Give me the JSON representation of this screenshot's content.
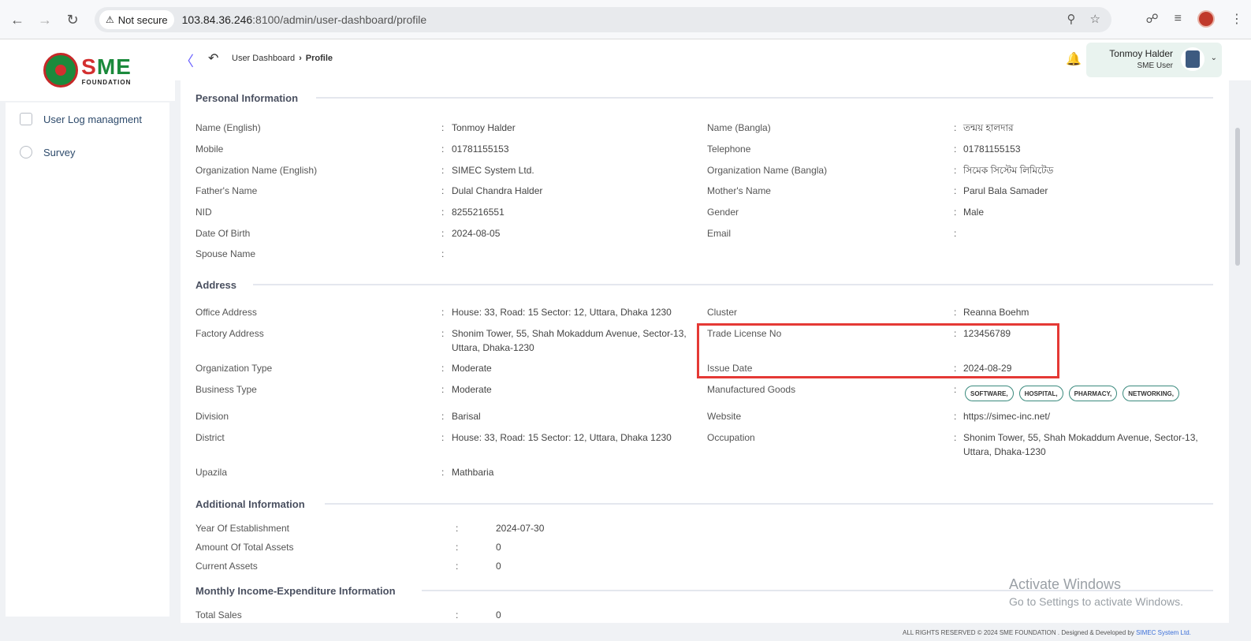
{
  "browser": {
    "security_label": "Not secure",
    "url_host": "103.84.36.246",
    "url_rest": ":8100/admin/user-dashboard/profile"
  },
  "logo": {
    "sme_s": "S",
    "sme_m": "M",
    "sme_e": "E",
    "foundation": "FOUNDATION"
  },
  "sidebar": {
    "items": [
      {
        "label": "User Log managment",
        "icon": "log-icon"
      },
      {
        "label": "Survey",
        "icon": "pie-chart-icon"
      }
    ]
  },
  "header": {
    "breadcrumb_parent": "User Dashboard",
    "breadcrumb_current": "Profile",
    "user_name": "Tonmoy Halder",
    "user_role": "SME User"
  },
  "sections": {
    "personal": "Personal Information",
    "address": "Address",
    "additional": "Additional Information",
    "monthly": "Monthly Income-Expenditure Information"
  },
  "personal": {
    "name_en_label": "Name (English)",
    "name_en": "Tonmoy Halder",
    "name_bn_label": "Name (Bangla)",
    "name_bn": "তন্ময় হালদার",
    "mobile_label": "Mobile",
    "mobile": "01781155153",
    "telephone_label": "Telephone",
    "telephone": "01781155153",
    "org_en_label": "Organization Name (English)",
    "org_en": "SIMEC System Ltd.",
    "org_bn_label": "Organization Name (Bangla)",
    "org_bn": "সিমেক সিস্টেম লিমিটেড",
    "father_label": "Father's Name",
    "father": "Dulal Chandra Halder",
    "mother_label": "Mother's Name",
    "mother": "Parul Bala Samader",
    "nid_label": "NID",
    "nid": "8255216551",
    "gender_label": "Gender",
    "gender": "Male",
    "dob_label": "Date Of Birth",
    "dob": "2024-08-05",
    "email_label": "Email",
    "email": "",
    "spouse_label": "Spouse Name",
    "spouse": ""
  },
  "address": {
    "office_label": "Office Address",
    "office": "House: 33, Road: 15 Sector: 12, Uttara, Dhaka 1230",
    "cluster_label": "Cluster",
    "cluster": "Reanna Boehm",
    "factory_label": "Factory Address",
    "factory": "Shonim Tower, 55, Shah Mokaddum Avenue, Sector-13, Uttara, Dhaka-1230",
    "trade_label": "Trade License No",
    "trade": "123456789",
    "orgtype_label": "Organization Type",
    "orgtype": "Moderate",
    "issue_label": "Issue Date",
    "issue": "2024-08-29",
    "business_label": "Business Type",
    "business": "Moderate",
    "goods_label": "Manufactured Goods",
    "goods": [
      "SOFTWARE,",
      "HOSPITAL,",
      "PHARMACY,",
      "NETWORKING,"
    ],
    "division_label": "Division",
    "division": "Barisal",
    "website_label": "Website",
    "website": "https://simec-inc.net/",
    "district_label": "District",
    "district": "House: 33, Road: 15 Sector: 12, Uttara, Dhaka 1230",
    "occupation_label": "Occupation",
    "occupation": "Shonim Tower, 55, Shah Mokaddum Avenue, Sector-13, Uttara, Dhaka-1230",
    "upazila_label": "Upazila",
    "upazila": "Mathbaria"
  },
  "additional": {
    "year_label": "Year Of Establishment",
    "year": "2024-07-30",
    "total_assets_label": "Amount Of Total Assets",
    "total_assets": "0",
    "current_assets_label": "Current Assets",
    "current_assets": "0"
  },
  "monthly": {
    "total_sales_label": "Total Sales",
    "total_sales": "0"
  },
  "colon": ":",
  "watermark": {
    "line1": "Activate Windows",
    "line2": "Go to Settings to activate Windows."
  },
  "footer": {
    "text": "ALL RIGHTS RESERVED © 2024 SME FOUNDATION . Designed & Developed by",
    "link": "SIMEC System Ltd."
  }
}
